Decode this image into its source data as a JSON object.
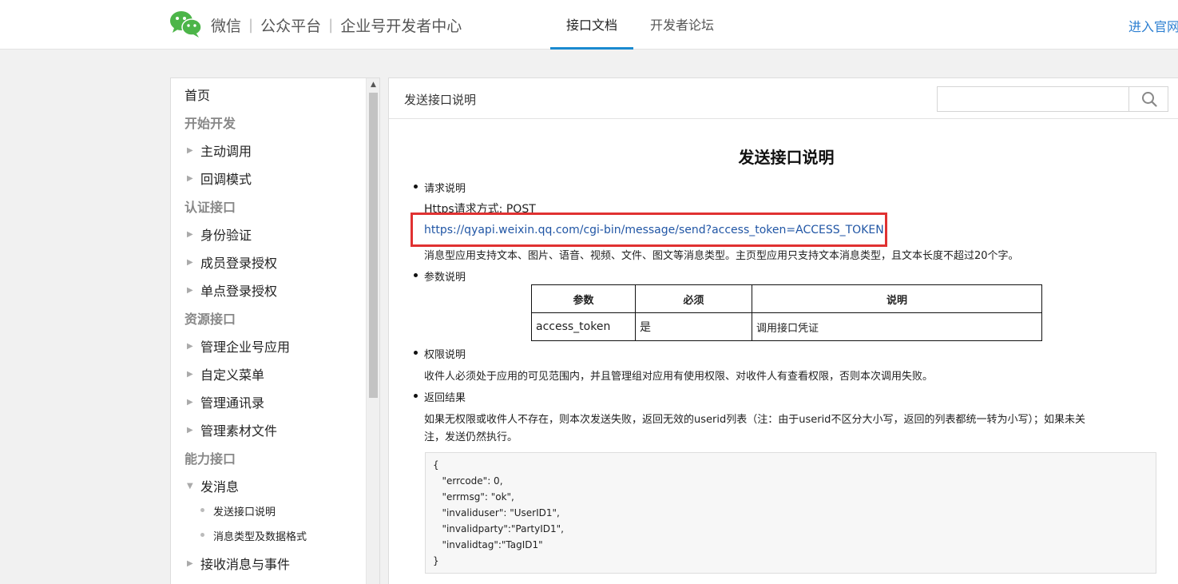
{
  "header": {
    "brand_parts": [
      "微信",
      "公众平台",
      "企业号开发者中心"
    ],
    "tabs": [
      {
        "label": "接口文档",
        "active": true
      },
      {
        "label": "开发者论坛",
        "active": false
      }
    ],
    "official_link": "进入官网"
  },
  "sidebar": {
    "home": "首页",
    "sections": [
      {
        "label": "开始开发"
      },
      {
        "label": "认证接口"
      },
      {
        "label": "资源接口"
      },
      {
        "label": "能力接口"
      }
    ],
    "items": [
      "主动调用",
      "回调模式",
      "身份验证",
      "成员登录授权",
      "单点登录授权",
      "管理企业号应用",
      "自定义菜单",
      "管理通讯录",
      "管理素材文件",
      "发消息",
      "接收消息与事件"
    ],
    "leaves": [
      "发送接口说明",
      "消息类型及数据格式"
    ]
  },
  "content": {
    "breadcrumb": "发送接口说明",
    "search_placeholder": "",
    "title": "发送接口说明",
    "request_heading": "请求说明",
    "method_line": "Https请求方式: POST",
    "url": "https://qyapi.weixin.qq.com/cgi-bin/message/send?access_token=ACCESS_TOKEN",
    "message_types_note": "消息型应用支持文本、图片、语音、视频、文件、图文等消息类型。主页型应用只支持文本消息类型，且文本长度不超过20个字。",
    "params_heading": "参数说明",
    "params_table": {
      "headers": [
        "参数",
        "必须",
        "说明"
      ],
      "rows": [
        [
          "access_token",
          "是",
          "调用接口凭证"
        ]
      ]
    },
    "permission_heading": "权限说明",
    "permission_text": "收件人必须处于应用的可见范围内，并且管理组对应用有使用权限、对收件人有查看权限，否则本次调用失败。",
    "result_heading": "返回结果",
    "result_text_1": "如果无权限或收件人不存在，则本次发送失败，返回无效的userid列表（注：由于userid不区分大小写，返回的列表都统一转为小写）；如果未关",
    "result_text_2": "注，发送仍然执行。",
    "code_lines": [
      "{",
      "   \"errcode\": 0,",
      "   \"errmsg\": \"ok\",",
      "   \"invaliduser\": \"UserID1\",",
      "   \"invalidparty\":\"PartyID1\",",
      "   \"invalidtag\":\"TagID1\"",
      "}"
    ]
  },
  "colors": {
    "accent": "#1a8ad0",
    "link": "#2156a5",
    "highlight": "#e03131",
    "wechat_green": "#4cb549"
  }
}
